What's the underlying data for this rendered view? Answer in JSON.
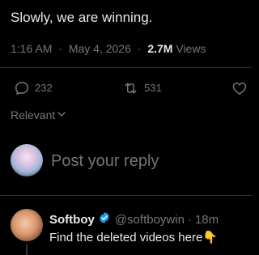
{
  "tweet": {
    "text": "Slowly, we are winning.",
    "time": "1:16 AM",
    "dot1": "·",
    "date": "May 4, 2026",
    "dot2": "·",
    "views_count": "2.7M",
    "views_label": "Views"
  },
  "actions": {
    "replies": "232",
    "reposts": "531"
  },
  "sort": {
    "label": "Relevant"
  },
  "reply_box": {
    "placeholder": "Post your reply"
  },
  "comment": {
    "name": "Softboy",
    "handle": "@softboywin",
    "dot": "·",
    "time": "18m",
    "text": "Find the deleted videos here",
    "emoji": "👇"
  },
  "colors": {
    "background": "#000000",
    "text": "#e7e9ea",
    "muted": "#71767b",
    "divider": "#2f3336",
    "verified": "#1d9bf0"
  }
}
